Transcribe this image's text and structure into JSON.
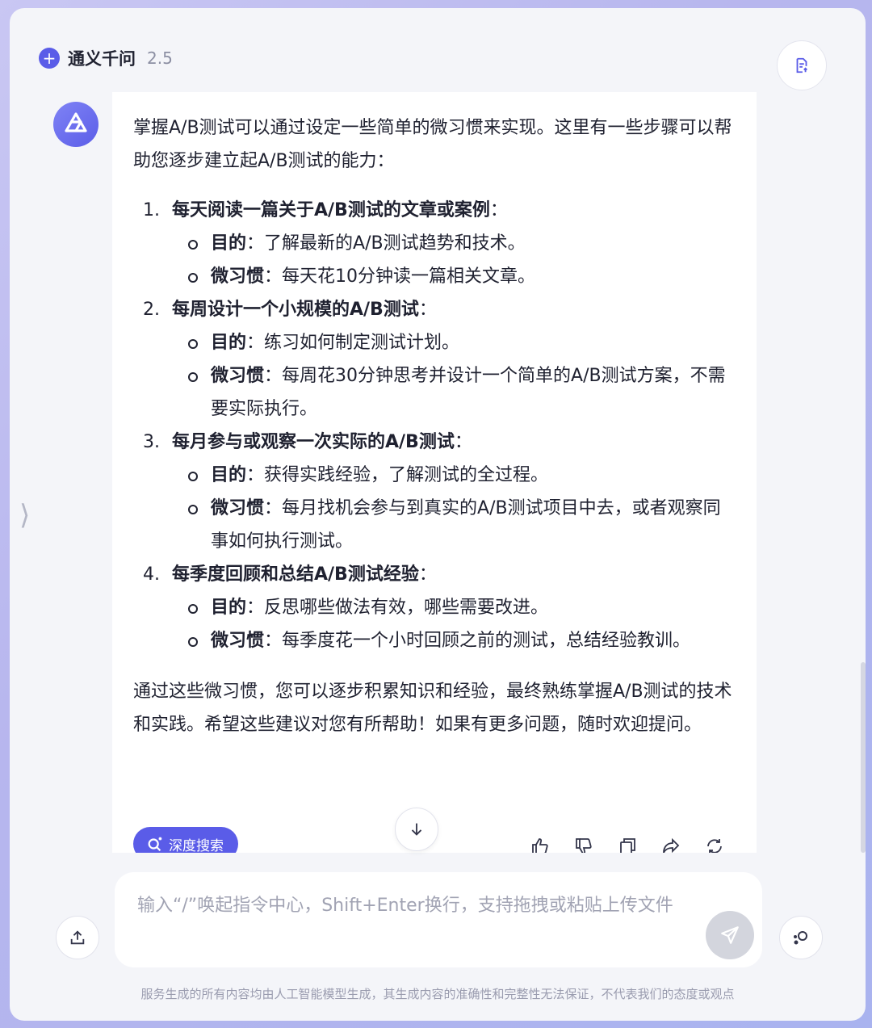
{
  "header": {
    "title": "通义千问",
    "version": "2.5"
  },
  "message": {
    "intro": "掌握A/B测试可以通过设定一些简单的微习惯来实现。这里有一些步骤可以帮助您逐步建立起A/B测试的能力：",
    "steps": [
      {
        "number": "1.",
        "title": "每天阅读一篇关于A/B测试的文章或案例",
        "colon": "：",
        "items": [
          {
            "label": "目的",
            "sep": "：",
            "text": "了解最新的A/B测试趋势和技术。"
          },
          {
            "label": "微习惯",
            "sep": "：",
            "text": "每天花10分钟读一篇相关文章。"
          }
        ]
      },
      {
        "number": "2.",
        "title": "每周设计一个小规模的A/B测试",
        "colon": "：",
        "items": [
          {
            "label": "目的",
            "sep": "：",
            "text": "练习如何制定测试计划。"
          },
          {
            "label": "微习惯",
            "sep": "：",
            "text": "每周花30分钟思考并设计一个简单的A/B测试方案，不需要实际执行。"
          }
        ]
      },
      {
        "number": "3.",
        "title": "每月参与或观察一次实际的A/B测试",
        "colon": "：",
        "items": [
          {
            "label": "目的",
            "sep": "：",
            "text": "获得实践经验，了解测试的全过程。"
          },
          {
            "label": "微习惯",
            "sep": "：",
            "text": "每月找机会参与到真实的A/B测试项目中去，或者观察同事如何执行测试。"
          }
        ]
      },
      {
        "number": "4.",
        "title": "每季度回顾和总结A/B测试经验",
        "colon": "：",
        "items": [
          {
            "label": "目的",
            "sep": "：",
            "text": "反思哪些做法有效，哪些需要改进。"
          },
          {
            "label": "微习惯",
            "sep": "：",
            "text": "每季度花一个小时回顾之前的测试，总结经验教训。"
          }
        ]
      }
    ],
    "outro": "通过这些微习惯，您可以逐步积累知识和经验，最终熟练掌握A/B测试的技术和实践。希望这些建议对您有所帮助！如果有更多问题，随时欢迎提问。",
    "deep_search_label": "深度搜索"
  },
  "input": {
    "placeholder": "输入“/”唤起指令中心，Shift+Enter换行，支持拖拽或粘贴上传文件"
  },
  "footer": {
    "disclaimer": "服务生成的所有内容均由人工智能模型生成，其生成内容的准确性和完整性无法保证，不代表我们的态度或观点"
  },
  "colors": {
    "accent": "#5a5ce8",
    "background": "#f4f5f9"
  }
}
